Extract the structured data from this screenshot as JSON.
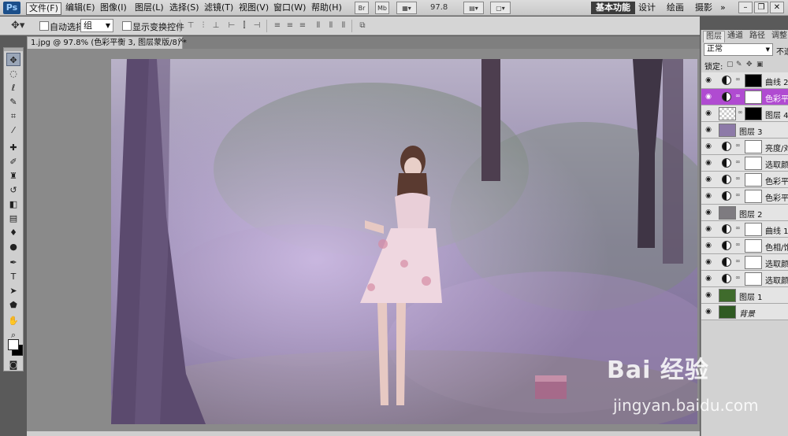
{
  "menu": {
    "logo": "Ps",
    "items": [
      "文件(F)",
      "编辑(E)",
      "图像(I)",
      "图层(L)",
      "选择(S)",
      "滤镜(T)",
      "视图(V)",
      "窗口(W)",
      "帮助(H)"
    ],
    "bridge": "Br",
    "minibridge": "Mb",
    "zoom": "97.8",
    "workspaces": [
      "基本功能",
      "设计",
      "绘画",
      "摄影"
    ],
    "more": "»"
  },
  "options": {
    "auto_select_label": "自动选择:",
    "auto_select_value": "组",
    "show_transform_label": "显示变换控件"
  },
  "document": {
    "tab_title": "1.jpg @ 97.8% (色彩平衡 3, 图层蒙版/8) *",
    "close": "×"
  },
  "layers_panel": {
    "tabs": [
      "图层",
      "通道",
      "路径",
      "调整"
    ],
    "blend_mode": "正常",
    "opacity_label": "不透",
    "lock_label": "锁定:",
    "layers": [
      {
        "name": "曲线 2",
        "kind": "adjustment",
        "selected": false,
        "mask": "black"
      },
      {
        "name": "色彩平",
        "kind": "adjustment",
        "selected": true,
        "mask": "white"
      },
      {
        "name": "图层 4",
        "kind": "masked-pixel",
        "selected": false,
        "mask": "black"
      },
      {
        "name": "图层 3",
        "kind": "pixel",
        "selected": false
      },
      {
        "name": "亮度/对",
        "kind": "adjustment",
        "selected": false,
        "mask": "white"
      },
      {
        "name": "选取颜",
        "kind": "adjustment",
        "selected": false,
        "mask": "white"
      },
      {
        "name": "色彩平",
        "kind": "adjustment",
        "selected": false,
        "mask": "white"
      },
      {
        "name": "色彩平",
        "kind": "adjustment",
        "selected": false,
        "mask": "white"
      },
      {
        "name": "图层 2",
        "kind": "pixel",
        "selected": false
      },
      {
        "name": "曲线 1",
        "kind": "adjustment",
        "selected": false,
        "mask": "white"
      },
      {
        "name": "色相/饱",
        "kind": "adjustment",
        "selected": false,
        "mask": "white"
      },
      {
        "name": "选取颜",
        "kind": "adjustment",
        "selected": false,
        "mask": "white"
      },
      {
        "name": "选取颜",
        "kind": "adjustment",
        "selected": false,
        "mask": "white"
      },
      {
        "name": "图层 1",
        "kind": "pixel",
        "selected": false
      },
      {
        "name": "背景",
        "kind": "background",
        "selected": false
      }
    ]
  },
  "watermark": {
    "brand": "Bai 经验",
    "url": "jingyan.baidu.com"
  },
  "colors": {
    "selected_layer": "#b04bd1",
    "photo_tint": "#9b86b5"
  }
}
